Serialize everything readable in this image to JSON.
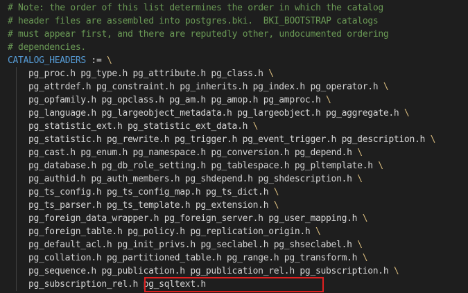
{
  "comment_lines": [
    "# Note: the order of this list determines the order in which the catalog",
    "# header files are assembled into postgres.bki.  BKI_BOOTSTRAP catalogs",
    "# must appear first, and there are reputedly other, undocumented ordering",
    "# dependencies."
  ],
  "assignment": {
    "variable": "CATALOG_HEADERS",
    "operator": " := ",
    "continuation": "\\"
  },
  "header_lines": [
    {
      "text": "pg_proc.h pg_type.h pg_attribute.h pg_class.h ",
      "cont": "\\"
    },
    {
      "text": "pg_attrdef.h pg_constraint.h pg_inherits.h pg_index.h pg_operator.h ",
      "cont": "\\"
    },
    {
      "text": "pg_opfamily.h pg_opclass.h pg_am.h pg_amop.h pg_amproc.h ",
      "cont": "\\"
    },
    {
      "text": "pg_language.h pg_largeobject_metadata.h pg_largeobject.h pg_aggregate.h ",
      "cont": "\\"
    },
    {
      "text": "pg_statistic_ext.h pg_statistic_ext_data.h ",
      "cont": "\\"
    },
    {
      "text": "pg_statistic.h pg_rewrite.h pg_trigger.h pg_event_trigger.h pg_description.h ",
      "cont": "\\"
    },
    {
      "text": "pg_cast.h pg_enum.h pg_namespace.h pg_conversion.h pg_depend.h ",
      "cont": "\\"
    },
    {
      "text": "pg_database.h pg_db_role_setting.h pg_tablespace.h pg_pltemplate.h ",
      "cont": "\\"
    },
    {
      "text": "pg_authid.h pg_auth_members.h pg_shdepend.h pg_shdescription.h ",
      "cont": "\\"
    },
    {
      "text": "pg_ts_config.h pg_ts_config_map.h pg_ts_dict.h ",
      "cont": "\\"
    },
    {
      "text": "pg_ts_parser.h pg_ts_template.h pg_extension.h ",
      "cont": "\\"
    },
    {
      "text": "pg_foreign_data_wrapper.h pg_foreign_server.h pg_user_mapping.h ",
      "cont": "\\"
    },
    {
      "text": "pg_foreign_table.h pg_policy.h pg_replication_origin.h ",
      "cont": "\\"
    },
    {
      "text": "pg_default_acl.h pg_init_privs.h pg_seclabel.h pg_shseclabel.h ",
      "cont": "\\"
    },
    {
      "text": "pg_collation.h pg_partitioned_table.h pg_range.h pg_transform.h ",
      "cont": "\\"
    },
    {
      "text": "pg_sequence.h pg_publication.h pg_publication_rel.h pg_subscription.h ",
      "cont": "\\"
    },
    {
      "text": "pg_subscription_rel.h pg_sqltext.h",
      "cont": ""
    }
  ],
  "colors": {
    "background": "#1e1e1e",
    "comment": "#6a9955",
    "variable": "#569cd6",
    "text": "#d4d4d4",
    "continuation": "#d7ba7d",
    "highlight_box": "#e02020"
  }
}
